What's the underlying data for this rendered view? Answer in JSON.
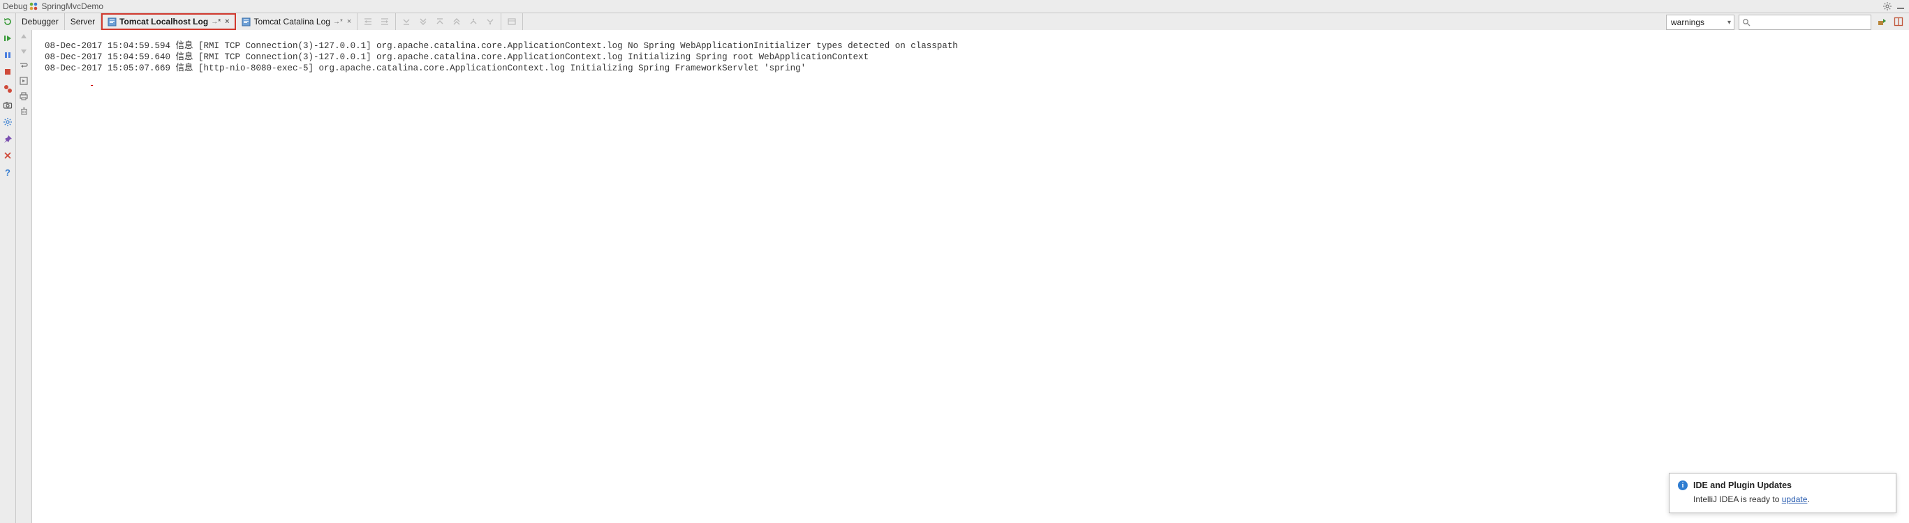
{
  "title": {
    "category": "Debug",
    "runconfig": "SpringMvcDemo"
  },
  "tabs": {
    "debugger": "Debugger",
    "server": "Server",
    "localhost_log": {
      "label": "Tomcat Localhost Log",
      "suffix": "→*"
    },
    "catalina_log": {
      "label": "Tomcat Catalina Log",
      "suffix": "→*"
    }
  },
  "filter": {
    "level": "warnings",
    "search_placeholder": ""
  },
  "log_lines": [
    "08-Dec-2017 15:04:59.594 信息 [RMI TCP Connection(3)-127.0.0.1] org.apache.catalina.core.ApplicationContext.log No Spring WebApplicationInitializer types detected on classpath",
    "08-Dec-2017 15:04:59.640 信息 [RMI TCP Connection(3)-127.0.0.1] org.apache.catalina.core.ApplicationContext.log Initializing Spring root WebApplicationContext",
    "08-Dec-2017 15:05:07.669 信息 [http-nio-8080-exec-5] org.apache.catalina.core.ApplicationContext.log Initializing Spring FrameworkServlet 'spring'"
  ],
  "notification": {
    "title": "IDE and Plugin Updates",
    "body_prefix": "IntelliJ IDEA is ready to ",
    "link_text": "update",
    "body_suffix": "."
  },
  "colors": {
    "highlight_border": "#d13a2f"
  }
}
